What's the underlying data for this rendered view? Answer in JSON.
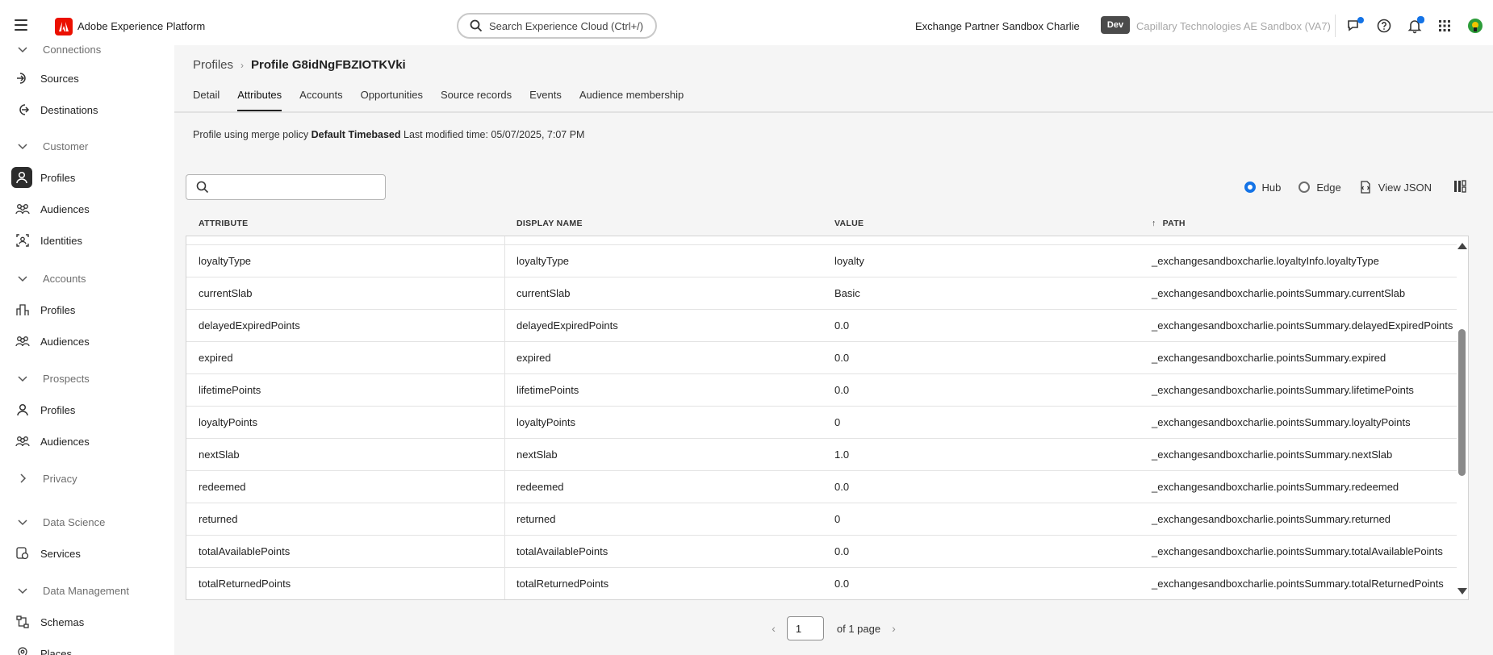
{
  "app": {
    "title": "Adobe Experience Platform",
    "search_placeholder": "Search Experience Cloud (Ctrl+/)",
    "org_name": "Exchange Partner Sandbox Charlie",
    "env_badge": "Dev",
    "sandbox_name": "Capillary Technologies AE Sandbox (VA7)"
  },
  "sidebar": {
    "items": [
      {
        "label": "Connections",
        "type": "section"
      },
      {
        "label": "Sources",
        "icon": "sources-icon"
      },
      {
        "label": "Destinations",
        "icon": "destinations-icon"
      },
      {
        "label": "Customer",
        "type": "section"
      },
      {
        "label": "Profiles",
        "icon": "profile-icon",
        "active": true
      },
      {
        "label": "Audiences",
        "icon": "audiences-icon"
      },
      {
        "label": "Identities",
        "icon": "identities-icon"
      },
      {
        "label": "Accounts",
        "type": "section"
      },
      {
        "label": "Profiles",
        "icon": "building-icon"
      },
      {
        "label": "Audiences",
        "icon": "audiences-icon"
      },
      {
        "label": "Prospects",
        "type": "section"
      },
      {
        "label": "Profiles",
        "icon": "profile-icon"
      },
      {
        "label": "Audiences",
        "icon": "audiences-icon"
      },
      {
        "label": "Privacy",
        "type": "section-collapsed"
      },
      {
        "label": "Data Science",
        "type": "section"
      },
      {
        "label": "Services",
        "icon": "services-icon"
      },
      {
        "label": "Data Management",
        "type": "section"
      },
      {
        "label": "Schemas",
        "icon": "schemas-icon"
      },
      {
        "label": "Places",
        "icon": "places-icon"
      }
    ]
  },
  "breadcrumb": {
    "parent": "Profiles",
    "separator": "›",
    "current": "Profile G8idNgFBZIOTKVki"
  },
  "tabs": [
    "Detail",
    "Attributes",
    "Accounts",
    "Opportunities",
    "Source records",
    "Events",
    "Audience membership"
  ],
  "active_tab": "Attributes",
  "policy": {
    "prefix": "Profile using merge policy ",
    "policy_name": "Default Timebased",
    "modified": " Last modified time: 05/07/2025, 7:07 PM"
  },
  "view": {
    "hub_label": "Hub",
    "edge_label": "Edge",
    "selected": "Hub",
    "view_json_label": "View JSON"
  },
  "table": {
    "headers": {
      "attribute": "ATTRIBUTE",
      "display_name": "DISPLAY NAME",
      "value": "VALUE",
      "path": "PATH",
      "path_sort": "↑"
    },
    "rows": [
      {
        "attribute": "loyaltyType",
        "display_name": "loyaltyType",
        "value": "loyalty",
        "path": "_exchangesandboxcharlie.loyaltyInfo.loyaltyType"
      },
      {
        "attribute": "currentSlab",
        "display_name": "currentSlab",
        "value": "Basic",
        "path": "_exchangesandboxcharlie.pointsSummary.currentSlab"
      },
      {
        "attribute": "delayedExpiredPoints",
        "display_name": "delayedExpiredPoints",
        "value": "0.0",
        "path": "_exchangesandboxcharlie.pointsSummary.delayedExpiredPoints"
      },
      {
        "attribute": "expired",
        "display_name": "expired",
        "value": "0.0",
        "path": "_exchangesandboxcharlie.pointsSummary.expired"
      },
      {
        "attribute": "lifetimePoints",
        "display_name": "lifetimePoints",
        "value": "0.0",
        "path": "_exchangesandboxcharlie.pointsSummary.lifetimePoints"
      },
      {
        "attribute": "loyaltyPoints",
        "display_name": "loyaltyPoints",
        "value": "0",
        "path": "_exchangesandboxcharlie.pointsSummary.loyaltyPoints"
      },
      {
        "attribute": "nextSlab",
        "display_name": "nextSlab",
        "value": "1.0",
        "path": "_exchangesandboxcharlie.pointsSummary.nextSlab"
      },
      {
        "attribute": "redeemed",
        "display_name": "redeemed",
        "value": "0.0",
        "path": "_exchangesandboxcharlie.pointsSummary.redeemed"
      },
      {
        "attribute": "returned",
        "display_name": "returned",
        "value": "0",
        "path": "_exchangesandboxcharlie.pointsSummary.returned"
      },
      {
        "attribute": "totalAvailablePoints",
        "display_name": "totalAvailablePoints",
        "value": "0.0",
        "path": "_exchangesandboxcharlie.pointsSummary.totalAvailablePoints"
      },
      {
        "attribute": "totalReturnedPoints",
        "display_name": "totalReturnedPoints",
        "value": "0.0",
        "path": "_exchangesandboxcharlie.pointsSummary.totalReturnedPoints"
      }
    ]
  },
  "pagination": {
    "prev": "‹",
    "page": "1",
    "of_label": "of 1 page",
    "next": "›"
  },
  "colors": {
    "accent": "#1473e6",
    "brand": "#eb1000",
    "background": "#f5f5f5"
  }
}
